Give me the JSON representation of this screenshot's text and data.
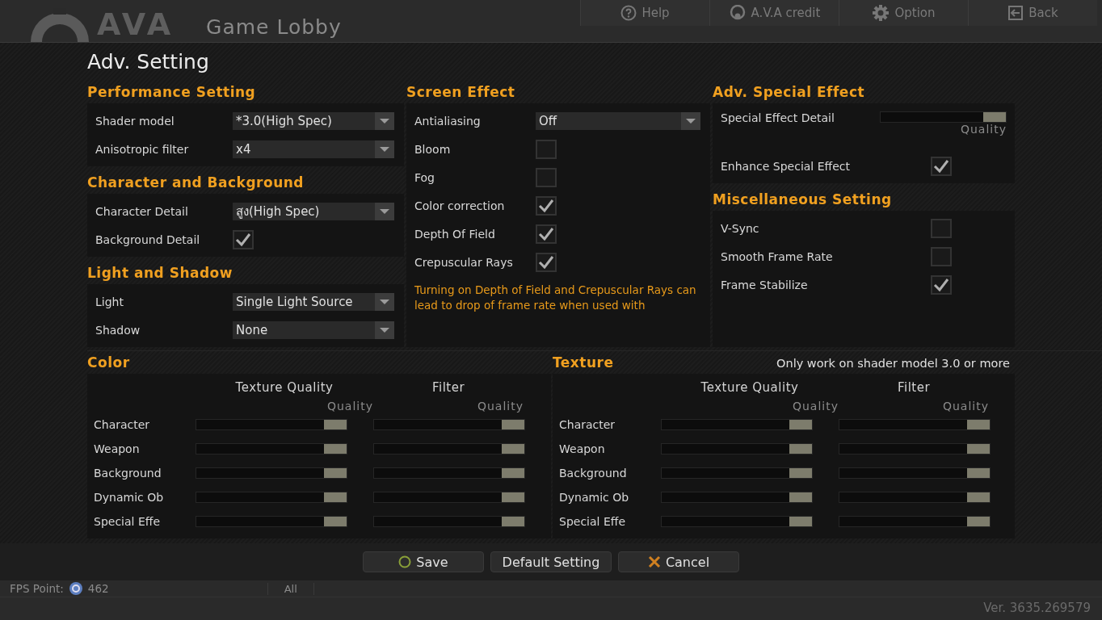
{
  "header": {
    "logo": "AVA",
    "title": "Game Lobby",
    "nav": [
      {
        "label": "Help",
        "kind": "help"
      },
      {
        "label": "A.V.A credit",
        "kind": "credit"
      },
      {
        "label": "Option",
        "kind": "option"
      },
      {
        "label": "Back",
        "kind": "back"
      }
    ]
  },
  "page_title": "Adv. Setting",
  "top_columns": [
    [
      {
        "title": "Performance Setting",
        "rows": [
          {
            "kind": "dropdown",
            "label": "Shader model",
            "value": "*3.0(High Spec)"
          },
          {
            "kind": "dropdown",
            "label": "Anisotropic filter",
            "value": "x4"
          }
        ]
      },
      {
        "title": "Character and Background",
        "rows": [
          {
            "kind": "dropdown",
            "label": "Character Detail",
            "value": "สูง(High Spec)"
          },
          {
            "kind": "checkbox",
            "label": "Background Detail",
            "checked": true
          }
        ]
      },
      {
        "title": "Light and Shadow",
        "rows": [
          {
            "kind": "dropdown",
            "label": "Light",
            "value": "Single Light Source"
          },
          {
            "kind": "dropdown",
            "label": "Shadow",
            "value": "None"
          }
        ]
      }
    ],
    [
      {
        "title": "Screen Effect",
        "rows": [
          {
            "kind": "dropdown",
            "label": "Antialiasing",
            "value": "Off"
          },
          {
            "kind": "checkbox",
            "label": "Bloom",
            "checked": false
          },
          {
            "kind": "checkbox",
            "label": "Fog",
            "checked": false
          },
          {
            "kind": "checkbox",
            "label": "Color correction",
            "checked": true
          },
          {
            "kind": "checkbox",
            "label": "Depth Of Field",
            "checked": true
          },
          {
            "kind": "checkbox",
            "label": "Crepuscular Rays",
            "checked": true
          }
        ],
        "note": "Turning on Depth of Field and Crepuscular Rays can lead to drop of frame rate when used with"
      }
    ],
    [
      {
        "title": "Adv. Special Effect",
        "rows": [
          {
            "kind": "slider",
            "label": "Special Effect Detail",
            "level": 1,
            "scale_label": "Quality"
          },
          {
            "kind": "checkbox",
            "label": "Enhance Special Effect",
            "checked": true
          }
        ]
      },
      {
        "title": "Miscellaneous Setting",
        "rows": [
          {
            "kind": "checkbox",
            "label": "V-Sync",
            "checked": false
          },
          {
            "kind": "checkbox",
            "label": "Smooth Frame Rate",
            "checked": false
          },
          {
            "kind": "checkbox",
            "label": "Frame Stabilize",
            "checked": true
          }
        ]
      }
    ]
  ],
  "bottom_panels": [
    {
      "title": "Color",
      "columns": [
        {
          "heading": "Texture Quality",
          "scale_label": "Quality"
        },
        {
          "heading": "Filter",
          "scale_label": "Quality"
        }
      ],
      "rows": [
        {
          "label": "Character",
          "levels": [
            {
              "level": 1
            },
            {
              "level": 1
            }
          ]
        },
        {
          "label": "Weapon",
          "levels": [
            {
              "level": 1
            },
            {
              "level": 1
            }
          ]
        },
        {
          "label": "Background",
          "levels": [
            {
              "level": 1
            },
            {
              "level": 1
            }
          ]
        },
        {
          "label": "Dynamic Ob",
          "levels": [
            {
              "level": 1
            },
            {
              "level": 1
            }
          ]
        },
        {
          "label": "Special Effe",
          "levels": [
            {
              "level": 1
            },
            {
              "level": 1
            }
          ]
        }
      ]
    },
    {
      "title": "Texture",
      "note": "Only work on shader model 3.0 or more",
      "columns": [
        {
          "heading": "Texture Quality",
          "scale_label": "Quality"
        },
        {
          "heading": "Filter",
          "scale_label": "Quality"
        }
      ],
      "rows": [
        {
          "label": "Character",
          "levels": [
            {
              "level": 1
            },
            {
              "level": 1
            }
          ]
        },
        {
          "label": "Weapon",
          "levels": [
            {
              "level": 1
            },
            {
              "level": 1
            }
          ]
        },
        {
          "label": "Background",
          "levels": [
            {
              "level": 1
            },
            {
              "level": 1
            }
          ]
        },
        {
          "label": "Dynamic Ob",
          "levels": [
            {
              "level": 1
            },
            {
              "level": 1
            }
          ]
        },
        {
          "label": "Special Effe",
          "levels": [
            {
              "level": 1
            },
            {
              "level": 1
            }
          ]
        }
      ]
    }
  ],
  "actions": [
    {
      "label": "Save",
      "kind": "save"
    },
    {
      "label": "Default Setting",
      "kind": "plain"
    },
    {
      "label": "Cancel",
      "kind": "cancel"
    }
  ],
  "status_bar": {
    "fps_label": "FPS Point:",
    "fps_value": "462",
    "channel": "All",
    "version": "Ver. 3635.269579"
  }
}
